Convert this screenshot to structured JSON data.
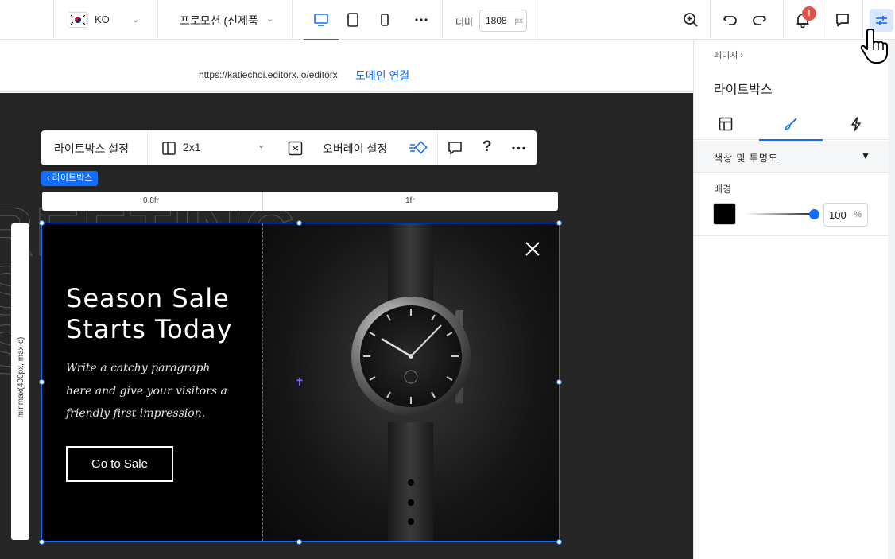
{
  "topbar": {
    "language_code": "KO",
    "page_name": "프로모션 (신제품",
    "width_label": "너비",
    "width_value": "1808",
    "width_unit": "px",
    "notification_badge": "!"
  },
  "urlbar": {
    "url": "https://katiechoi.editorx.io/editorx",
    "domain_link": "도메인 연결"
  },
  "lightbox_toolbar": {
    "settings_label": "라이트박스 설정",
    "layout_label": "2x1",
    "overlay_label": "오버레이 설정"
  },
  "lightbox_tag": "‹ 라이트박스",
  "grid": {
    "col1": "0.8fr",
    "col2": "1fr",
    "row_label": "minmax(400px, max-c)"
  },
  "lightbox": {
    "headline_line1": "Season Sale",
    "headline_line2": "Starts Today",
    "paragraph": "Write a catchy paragraph here and give your visitors a friendly first impression.",
    "cta_label": "Go to Sale"
  },
  "background_text": "REETING\nS\nS",
  "panel": {
    "breadcrumb": "페이지  ›",
    "title": "라이트박스",
    "section_title": "색상 및 투명도",
    "background_label": "배경",
    "opacity_value": "100",
    "opacity_unit": "%",
    "background_color": "#000000"
  },
  "colors": {
    "accent": "#116dff",
    "canvas": "#262626",
    "badge": "#e0534d"
  }
}
